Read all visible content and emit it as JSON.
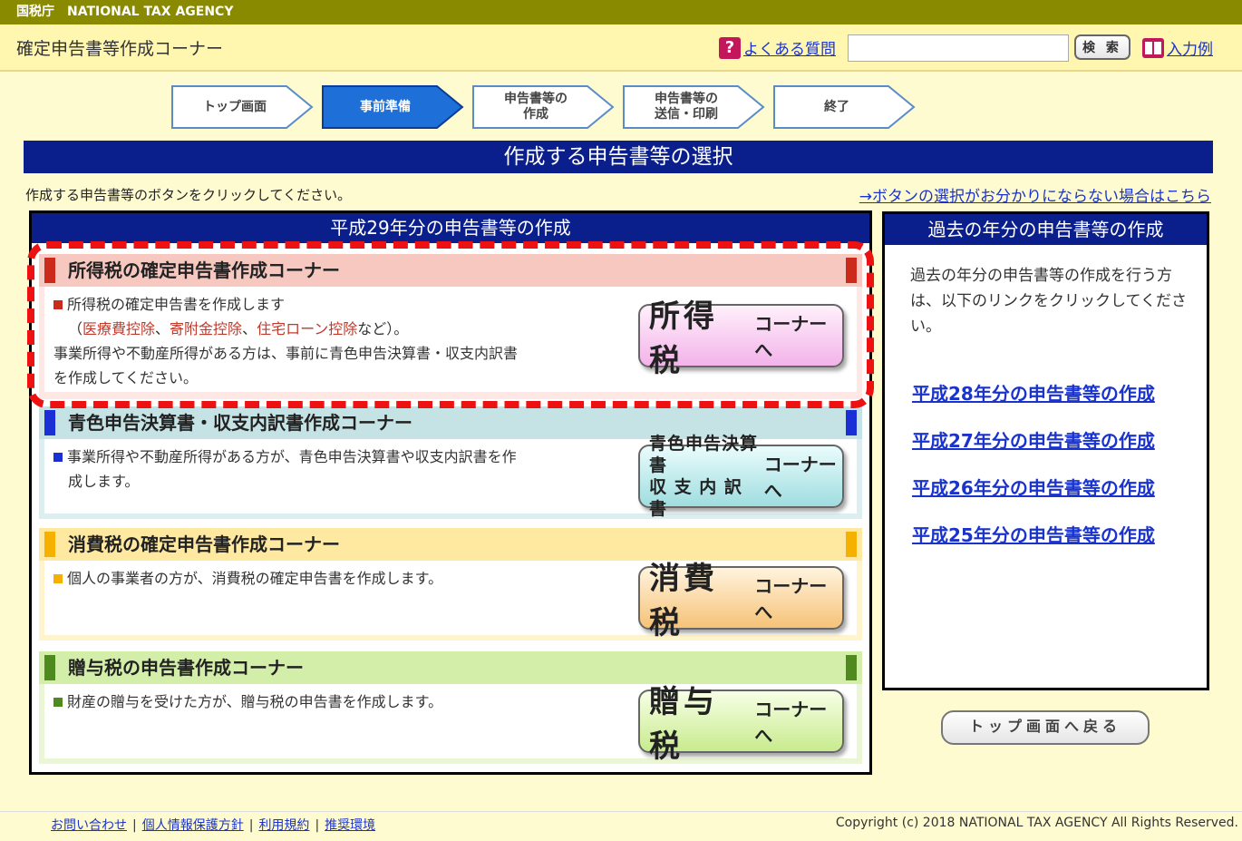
{
  "topbar": {
    "agency_jp": "国税庁",
    "agency_en": "NATIONAL TAX AGENCY"
  },
  "header": {
    "title": "確定申告書等作成コーナー",
    "faq": "よくある質問",
    "search_value": "",
    "search_button": "検 索",
    "input_example": "入力例"
  },
  "steps": [
    {
      "line1": "トップ画面",
      "line2": ""
    },
    {
      "line1": "事前準備",
      "line2": ""
    },
    {
      "line1": "申告書等の",
      "line2": "作成"
    },
    {
      "line1": "申告書等の",
      "line2": "送信・印刷"
    },
    {
      "line1": "終了",
      "line2": ""
    }
  ],
  "page_title": "作成する申告書等の選択",
  "instruction": "作成する申告書等のボタンをクリックしてください。",
  "help_link": "→ボタンの選択がお分かりにならない場合はこちら",
  "main": {
    "heading": "平成29年分の申告書等の作成",
    "income": {
      "title": "所得税の確定申告書作成コーナー",
      "line1": "所得税の確定申告書を作成します",
      "paren_open": "（",
      "d1": "医療費控除",
      "sep1": "、",
      "d2": "寄附金控除",
      "sep2": "、",
      "d3": "住宅ローン控除",
      "paren_close": "など）。",
      "line3": "事業所得や不動産所得がある方は、事前に青色申告決算書・収支内訳書",
      "line4": "を作成してください。",
      "btn_main": "所得税",
      "btn_to": "コーナーへ"
    },
    "blue": {
      "title": "青色申告決算書・収支内訳書作成コーナー",
      "line1": "事業所得や不動産所得がある方が、青色申告決算書や収支内訳書を作",
      "line2": "成します。",
      "btn_line1": "青色申告決算書",
      "btn_line2": "収 支 内 訳 書",
      "btn_to": "コーナーへ"
    },
    "consumption": {
      "title": "消費税の確定申告書作成コーナー",
      "line1": "個人の事業者の方が、消費税の確定申告書を作成します。",
      "btn_main": "消費税",
      "btn_to": "コーナーへ"
    },
    "gift": {
      "title": "贈与税の申告書作成コーナー",
      "line1": "財産の贈与を受けた方が、贈与税の申告書を作成します。",
      "btn_main": "贈与税",
      "btn_to": "コーナーへ"
    }
  },
  "past": {
    "heading": "過去の年分の申告書等の作成",
    "text": "過去の年分の申告書等の作成を行う方は、以下のリンクをクリックしてください。",
    "links": [
      "平成28年分の申告書等の作成",
      "平成27年分の申告書等の作成",
      "平成26年分の申告書等の作成",
      "平成25年分の申告書等の作成"
    ]
  },
  "back_button": "トップ画面へ戻る",
  "footer": {
    "links": [
      "お問い合わせ",
      "個人情報保護方針",
      "利用規約",
      "推奨環境"
    ],
    "separator": "|",
    "copyright": "Copyright (c) 2018 NATIONAL TAX AGENCY All Rights Reserved."
  },
  "colors": {
    "navy": "#0a1e8c",
    "income": "#cc2a1a",
    "blue": "#1a2fd6",
    "consumption": "#f5b000",
    "gift": "#4f8a1e",
    "highlight_dash": "#ee1111"
  }
}
